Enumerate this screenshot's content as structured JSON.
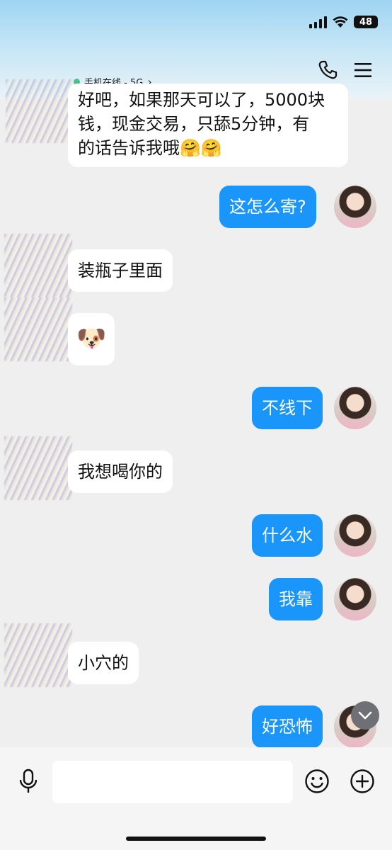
{
  "status_bar": {
    "battery": "48"
  },
  "header": {
    "online_status": "手机在线 - 5G",
    "chevron": "›",
    "icons": [
      "phone-icon",
      "menu-icon"
    ]
  },
  "messages": [
    {
      "side": "in",
      "text_lines": [
        "好吧，如果那天可以了，5000块",
        "钱，现金交易，只舔5分钟，有",
        "的话告诉我哦🤗🤗"
      ]
    },
    {
      "side": "out",
      "text": "这怎么寄?"
    },
    {
      "side": "in",
      "text": "装瓶子里面"
    },
    {
      "side": "in",
      "text": "🐶"
    },
    {
      "side": "out",
      "text": "不线下"
    },
    {
      "side": "in",
      "text": "我想喝你的"
    },
    {
      "side": "out",
      "text": "什么水"
    },
    {
      "side": "out",
      "text": "我靠"
    },
    {
      "side": "in",
      "text": "小穴的"
    },
    {
      "side": "out",
      "text": "好恐怖"
    }
  ],
  "input": {
    "value": "",
    "placeholder": ""
  },
  "colors": {
    "accent": "#1a95f9",
    "incoming": "#ffffff",
    "background": "#efefef"
  }
}
